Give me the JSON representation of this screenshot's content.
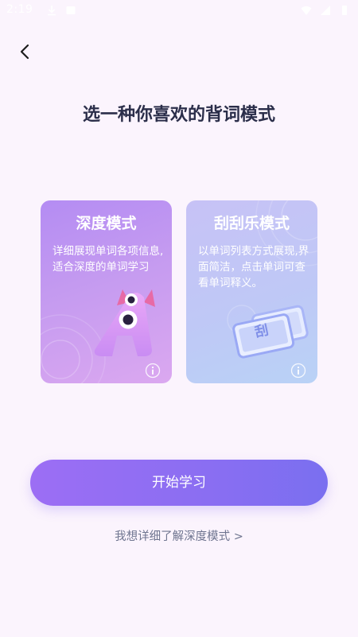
{
  "status_bar": {
    "time": "2:19",
    "left_icons": [
      "download-icon",
      "image-icon"
    ],
    "right_icons": [
      "wifi-icon",
      "signal-icon",
      "battery-icon"
    ]
  },
  "header": {
    "back_icon": "chevron-left-icon"
  },
  "page": {
    "title": "选一种你喜欢的背词模式"
  },
  "modes": [
    {
      "title": "深度模式",
      "description": "详细展现单词各项信息,适合深度的单词学习",
      "icon": "info-icon"
    },
    {
      "title": "刮刮乐模式",
      "description": "以单词列表方式展现,界面简洁，点击单词可查看单词释义。",
      "badge": "刮",
      "icon": "info-icon"
    }
  ],
  "actions": {
    "start_label": "开始学习",
    "learn_more_label": "我想详细了解深度模式 >"
  },
  "colors": {
    "background": "#fbf4fd",
    "title": "#2b2e4a",
    "deep_card": "#b48cf3",
    "scratch_card": "#c7c2f6",
    "button": "#8a6ef2",
    "link": "#6f7590"
  }
}
